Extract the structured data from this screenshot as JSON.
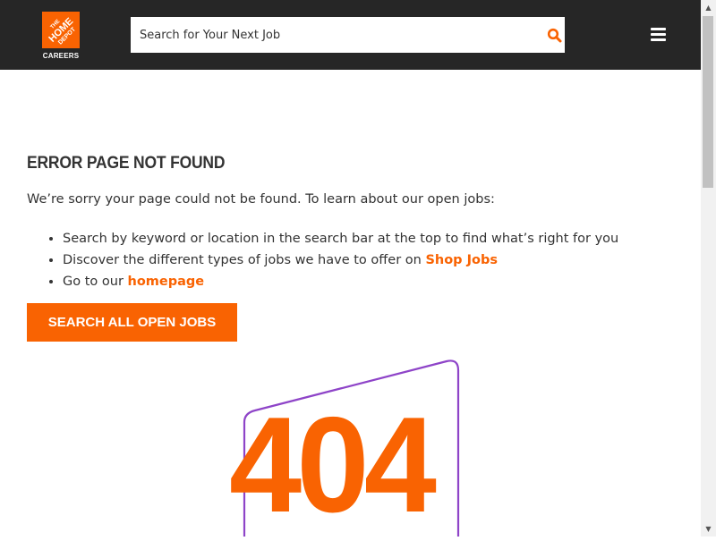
{
  "header": {
    "logo_text": "CAREERS",
    "logo_wordmark": "THE HOME DEPOT",
    "search_placeholder": "Search for Your Next Job",
    "search_icon": "magnifier-icon",
    "menu_icon": "hamburger-menu-icon"
  },
  "main": {
    "title": "ERROR PAGE NOT FOUND",
    "intro": "We’re sorry your page could not be found. To learn about our open jobs:",
    "bullets": [
      {
        "text": "Search by keyword or location in the search bar at the top to find what’s right for you"
      },
      {
        "text": "Discover the different types of jobs we have to offer on ",
        "link": "Shop Jobs"
      },
      {
        "text": "Go to our ",
        "link": "homepage"
      }
    ],
    "cta_label": "SEARCH ALL OPEN JOBS",
    "error_code": "404"
  },
  "colors": {
    "brand_orange": "#f96302",
    "header_bg": "#262626",
    "accent_purple": "#8e44c8"
  }
}
